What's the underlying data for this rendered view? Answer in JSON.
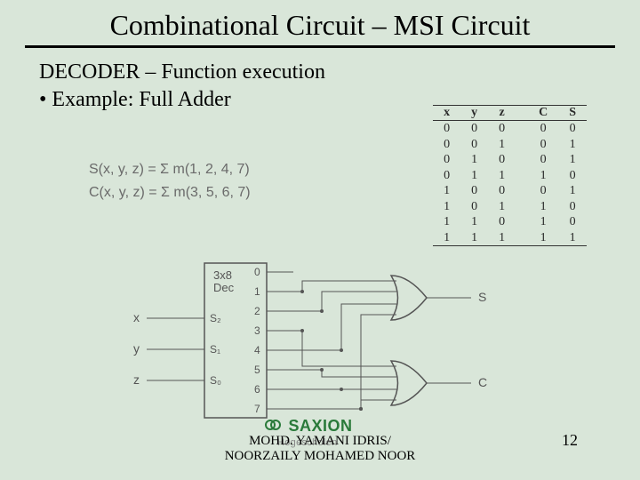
{
  "title": "Combinational Circuit – MSI Circuit",
  "subtitle": "DECODER – Function execution",
  "bullet": "• Example: Full Adder",
  "formulas": {
    "s": "S(x, y, z) = Σ m(1, 2, 4, 7)",
    "c": "C(x, y, z) = Σ m(3, 5, 6, 7)"
  },
  "truth": {
    "headers": [
      "x",
      "y",
      "z",
      "C",
      "S"
    ],
    "rows": [
      [
        "0",
        "0",
        "0",
        "0",
        "0"
      ],
      [
        "0",
        "0",
        "1",
        "0",
        "1"
      ],
      [
        "0",
        "1",
        "0",
        "0",
        "1"
      ],
      [
        "0",
        "1",
        "1",
        "1",
        "0"
      ],
      [
        "1",
        "0",
        "0",
        "0",
        "1"
      ],
      [
        "1",
        "0",
        "1",
        "1",
        "0"
      ],
      [
        "1",
        "1",
        "0",
        "1",
        "0"
      ],
      [
        "1",
        "1",
        "1",
        "1",
        "1"
      ]
    ]
  },
  "circuit": {
    "block": "3x8\nDec",
    "inputs": [
      {
        "label": "x",
        "pin": "S₂"
      },
      {
        "label": "y",
        "pin": "S₁"
      },
      {
        "label": "z",
        "pin": "S₀"
      }
    ],
    "outputs": [
      "0",
      "1",
      "2",
      "3",
      "4",
      "5",
      "6",
      "7"
    ],
    "gates": [
      {
        "out": "S",
        "minterms": [
          1,
          2,
          4,
          7
        ]
      },
      {
        "out": "C",
        "minterms": [
          3,
          5,
          6,
          7
        ]
      }
    ]
  },
  "footer": {
    "brand": "SAXION",
    "sub": "Hogescholen",
    "credit1": "MOHD. YAMANI IDRIS/",
    "credit2": "NOORZAILY MOHAMED NOOR"
  },
  "page": "12"
}
